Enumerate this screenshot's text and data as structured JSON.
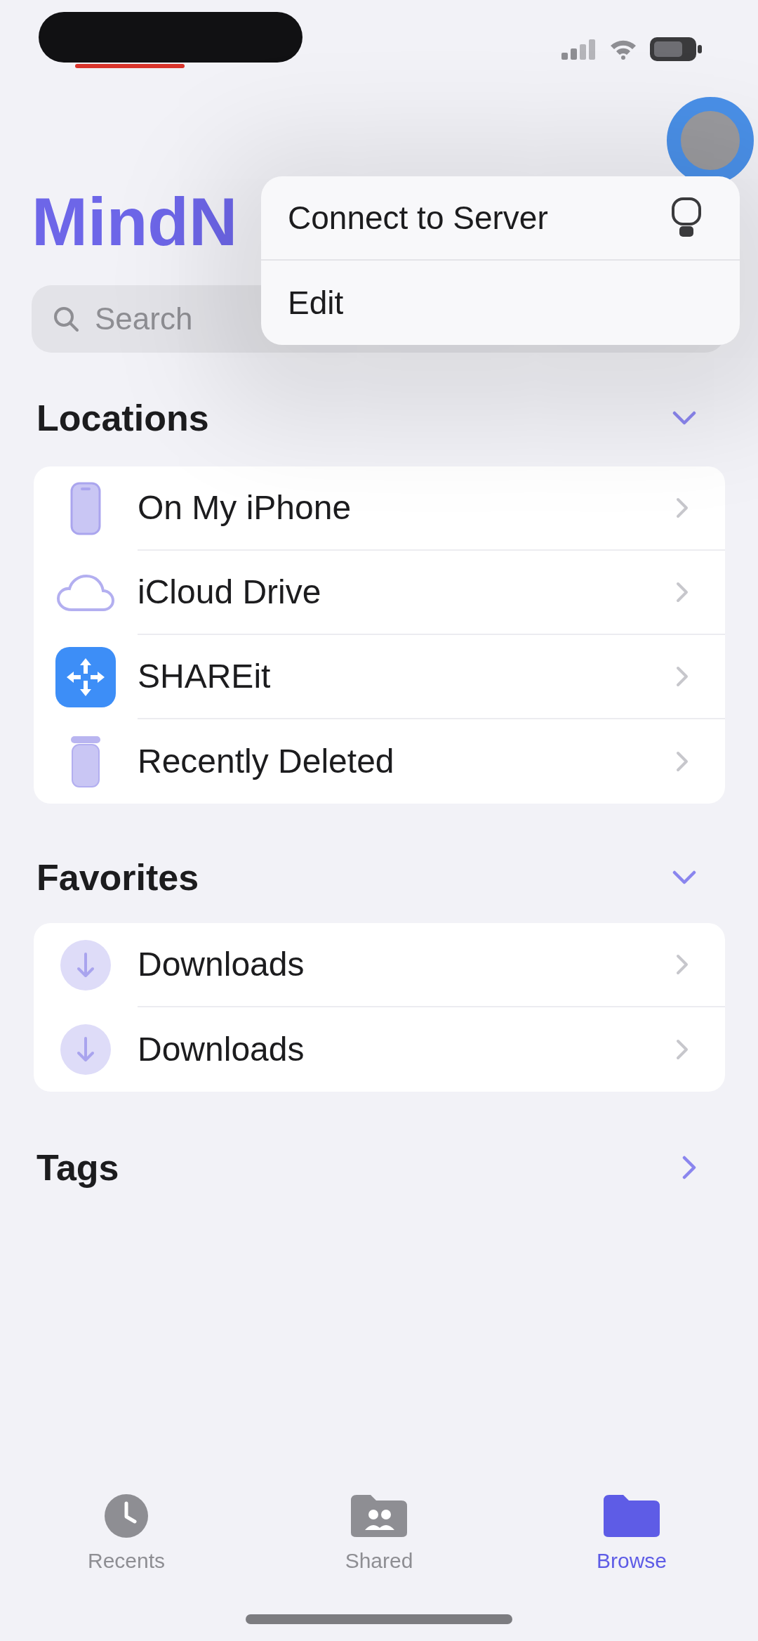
{
  "title": "MindN",
  "search": {
    "placeholder": "Search"
  },
  "menu": {
    "items": [
      {
        "label": "Connect to Server",
        "kind": "server"
      },
      {
        "label": "Edit",
        "kind": "plain"
      }
    ]
  },
  "sections": [
    {
      "title": "Locations",
      "expanded": true,
      "items": [
        {
          "label": "On My iPhone",
          "kind": "phone"
        },
        {
          "label": "iCloud Drive",
          "kind": "cloud"
        },
        {
          "label": "SHAREit",
          "kind": "app"
        },
        {
          "label": "Recently Deleted",
          "kind": "trash"
        }
      ]
    },
    {
      "title": "Favorites",
      "expanded": true,
      "items": [
        {
          "label": "Downloads",
          "kind": "download"
        },
        {
          "label": "Downloads",
          "kind": "download"
        }
      ]
    },
    {
      "title": "Tags",
      "expanded": false
    }
  ],
  "tab_bar": [
    {
      "label": "Recents",
      "kind": "clock",
      "selected": false
    },
    {
      "label": "Shared",
      "kind": "shared",
      "selected": false
    },
    {
      "label": "Browse",
      "kind": "folder",
      "selected": true
    }
  ]
}
